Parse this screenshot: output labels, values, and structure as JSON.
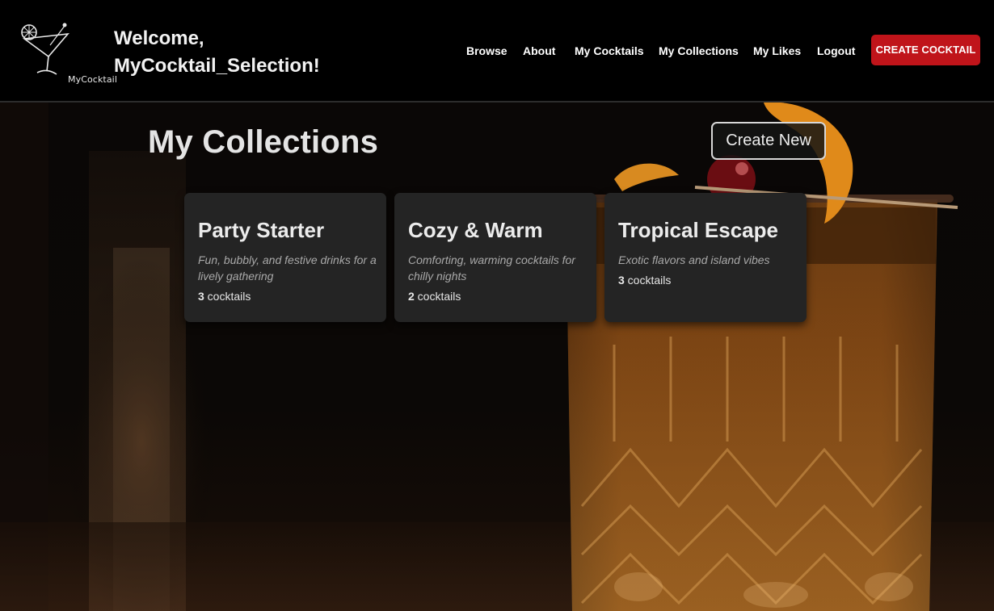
{
  "header": {
    "logo_text": "MyCocktail",
    "welcome_line1": "Welcome,",
    "welcome_line2": "MyCocktail_Selection!",
    "nav": [
      {
        "label": "Browse"
      },
      {
        "label": "About"
      },
      {
        "label": "My Cocktails"
      },
      {
        "label": "My Collections"
      },
      {
        "label": "My Likes"
      },
      {
        "label": "Logout"
      }
    ],
    "create_button": "CREATE COCKTAIL"
  },
  "main": {
    "title": "My Collections",
    "create_new": "Create New",
    "collections": [
      {
        "title": "Party Starter",
        "description": "Fun, bubbly, and festive drinks for a lively gathering",
        "count": "3",
        "count_unit": " cocktails"
      },
      {
        "title": "Cozy & Warm",
        "description": "Comforting, warming cocktails for chilly nights",
        "count": "2",
        "count_unit": " cocktails"
      },
      {
        "title": "Tropical Escape",
        "description": "Exotic flavors and island vibes",
        "count": "3",
        "count_unit": " cocktails"
      }
    ]
  },
  "colors": {
    "accent_red": "#c0141a",
    "card_bg": "#242424",
    "header_bg": "#000000"
  },
  "icons": {
    "logo": "martini-glass-icon",
    "background": "whiskey-glass-photo"
  }
}
